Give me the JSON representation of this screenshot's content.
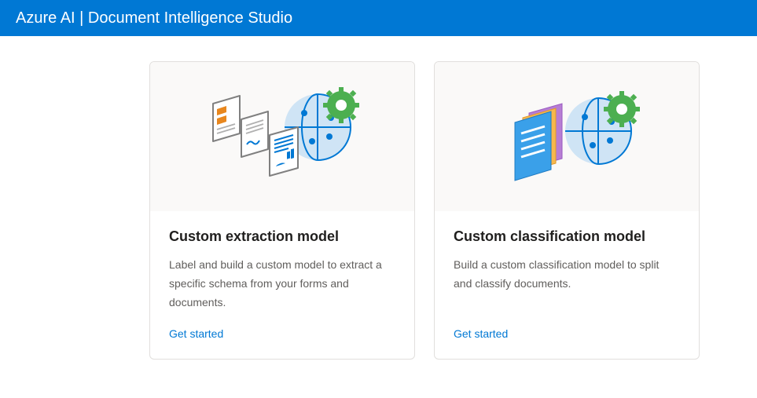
{
  "header": {
    "title": "Azure AI | Document Intelligence Studio"
  },
  "cards": [
    {
      "title": "Custom extraction model",
      "description": "Label and build a custom model to extract a specific schema from your forms and documents.",
      "cta": "Get started",
      "icon": "documents-gear"
    },
    {
      "title": "Custom classification model",
      "description": "Build a custom classification model to split and classify documents.",
      "cta": "Get started",
      "icon": "stacked-docs-gear"
    }
  ],
  "colors": {
    "brand": "#0078D4",
    "accent_green": "#4CAF50"
  }
}
